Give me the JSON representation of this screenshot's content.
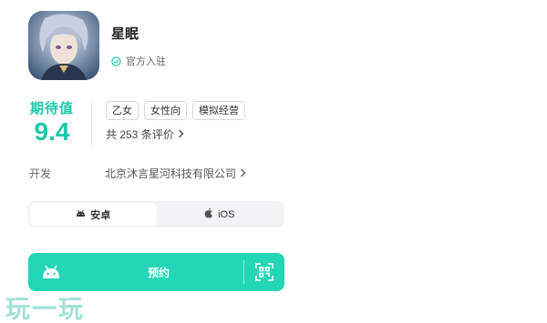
{
  "app": {
    "title": "星眠",
    "verified_label": "官方入驻"
  },
  "rating": {
    "label": "期待值",
    "value": "9.4"
  },
  "tags": [
    "乙女",
    "女性向",
    "模拟经营"
  ],
  "reviews": {
    "text": "共 253 条评价"
  },
  "developer": {
    "label": "开发",
    "name": "北京沐言星河科技有限公司"
  },
  "platforms": [
    {
      "label": "安卓",
      "icon": "android-icon",
      "selected": true
    },
    {
      "label": "iOS",
      "icon": "apple-icon",
      "selected": false
    }
  ],
  "action": {
    "label": "预约",
    "left_icon": "android-icon",
    "right_icon": "qr-scan-icon"
  },
  "watermark": {
    "text": "玩一玩"
  },
  "colors": {
    "accent": "#19c9a9",
    "button": "#22d6b6"
  }
}
